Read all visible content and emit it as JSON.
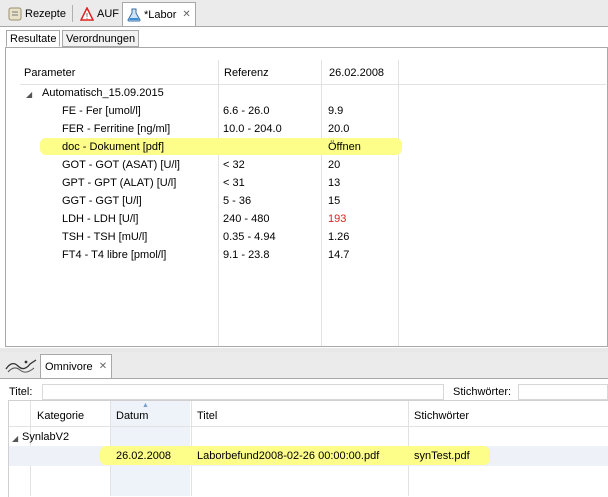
{
  "editor_tabs": [
    {
      "label": "Rezepte",
      "icon": "recipe-icon"
    },
    {
      "label": "AUF",
      "icon": "warning-icon"
    },
    {
      "label": "*Labor",
      "icon": "lab-flask-icon"
    }
  ],
  "sub_tabs": [
    "Resultate",
    "Verordnungen"
  ],
  "lab_table": {
    "headers": [
      "Parameter",
      "Referenz",
      "26.02.2008"
    ],
    "group": "Automatisch_15.09.2015",
    "rows": [
      {
        "param": "FE - Fer [umol/l]",
        "ref": "6.6 - 26.0",
        "val": "9.9"
      },
      {
        "param": "FER - Ferritine [ng/ml]",
        "ref": "10.0 - 204.0",
        "val": "20.0"
      },
      {
        "param": "doc - Dokument [pdf]",
        "ref": "",
        "val": "Öffnen"
      },
      {
        "param": "GOT - GOT (ASAT) [U/l]",
        "ref": "< 32",
        "val": "20"
      },
      {
        "param": "GPT - GPT (ALAT) [U/l]",
        "ref": "< 31",
        "val": "13"
      },
      {
        "param": "GGT - GGT [U/l]",
        "ref": "5 - 36",
        "val": "15"
      },
      {
        "param": "LDH - LDH [U/l]",
        "ref": "240 - 480",
        "val": "193"
      },
      {
        "param": "TSH - TSH [mU/l]",
        "ref": "0.35 - 4.94",
        "val": "1.26"
      },
      {
        "param": "FT4 - T4 libre [pmol/l]",
        "ref": "9.1 - 23.8",
        "val": "14.7"
      }
    ],
    "highlight_color": "#fdfd8a",
    "abnormal_color": "#e02020"
  },
  "omnivore": {
    "tab_label": "Omnivore",
    "title_label": "Titel:",
    "keywords_label": "Stichwörter:",
    "headers": [
      "Kategorie",
      "Datum",
      "Titel",
      "Stichwörter"
    ],
    "group": "SynlabV2",
    "row": {
      "date": "26.02.2008",
      "title": "Laborbefund2008-02-26 00:00:00.pdf",
      "keywords": "synTest.pdf"
    }
  }
}
